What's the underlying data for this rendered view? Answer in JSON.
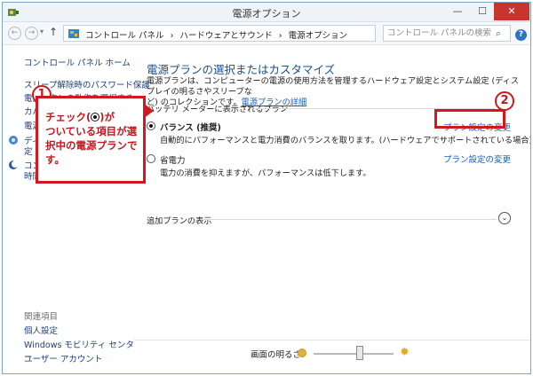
{
  "window": {
    "title": "電源オプション",
    "minimize": "—",
    "maximize": "☐",
    "close": "✕"
  },
  "address": {
    "crumbs": [
      "コントロール パネル",
      "›",
      "ハードウェアとサウンド",
      "›",
      "電源オプション"
    ],
    "search_placeholder": "コントロール パネルの検索"
  },
  "sidebar": {
    "home": "コントロール パネル ホーム",
    "items": [
      "スリープ解除時のパスワード保護",
      "電源ボタンの動作を選択する",
      "カバー",
      "電源",
      "ディ",
      "定",
      "コン",
      "時間"
    ],
    "related_heading": "関連項目",
    "related": [
      "個人設定",
      "Windows モビリティ センター",
      "ユーザー アカウント"
    ]
  },
  "main": {
    "title": "電源プランの選択またはカスタマイズ",
    "desc_line1": "電源プランは、コンピューターの電源の使用方法を管理するハードウェア設定とシステム設定 (ディスプレイの明るさやスリープな",
    "desc_line2_prefix": "ど) のコレクションです。",
    "desc_link": "電源プランの詳細",
    "group_heading": "バッテリ メーターに表示されるプラン",
    "plans": [
      {
        "name": "バランス (推奨)",
        "desc": "自動的にパフォーマンスと電力消費のバランスを取ります。(ハードウェアでサポートされている場合)",
        "link": "プラン設定の変更",
        "selected": true
      },
      {
        "name": "省電力",
        "desc": "電力の消費を抑えますが、パフォーマンスは低下します。",
        "link": "プラン設定の変更",
        "selected": false
      }
    ],
    "extra_heading": "追加プランの表示"
  },
  "brightness": {
    "label": "画面の明るさ:",
    "level": 0.58
  },
  "annotations": {
    "callout1_number": "1",
    "callout1_text_a": "チェック(",
    "callout1_text_b": ")が",
    "callout1_text_c": "ついている項目が選択中の電源プランです。",
    "callout2_number": "2"
  },
  "colors": {
    "accent_red": "#d0181e",
    "link_blue": "#1a5fb4",
    "title_blue": "#1a4f8b"
  }
}
